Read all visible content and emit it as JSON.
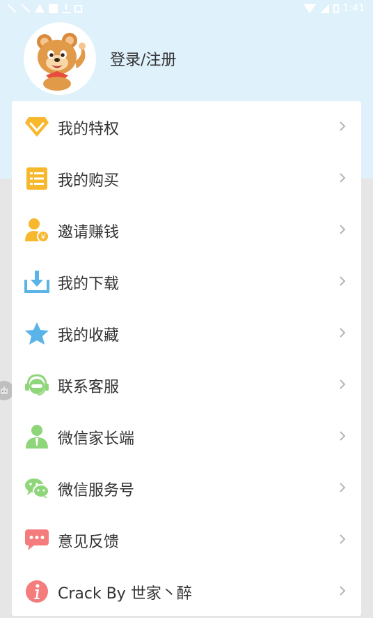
{
  "status_bar": {
    "time": "1:41"
  },
  "profile": {
    "login_label": "登录/注册",
    "avatar_icon": "bear-mascot-icon"
  },
  "menu": {
    "items": [
      {
        "label": "我的特权",
        "icon": "diamond-icon",
        "color": "#f7b82e"
      },
      {
        "label": "我的购买",
        "icon": "list-icon",
        "color": "#f7b82e"
      },
      {
        "label": "邀请赚钱",
        "icon": "user-coin-icon",
        "color": "#f7b82e"
      },
      {
        "label": "我的下载",
        "icon": "download-icon",
        "color": "#5ab4e8"
      },
      {
        "label": "我的收藏",
        "icon": "star-icon",
        "color": "#5ab4e8"
      },
      {
        "label": "联系客服",
        "icon": "service-icon",
        "color": "#8fd67a"
      },
      {
        "label": "微信家长端",
        "icon": "person-icon",
        "color": "#8fd67a"
      },
      {
        "label": "微信服务号",
        "icon": "wechat-icon",
        "color": "#8fd67a"
      },
      {
        "label": "意见反馈",
        "icon": "chat-bubble-icon",
        "color": "#f47c7c"
      },
      {
        "label": "Crack By 世家丶醉",
        "icon": "info-icon",
        "color": "#f47c7c"
      }
    ]
  },
  "colors": {
    "header_bg": "#dff1fb",
    "page_bg": "#e6e6e6",
    "card_bg": "#ffffff",
    "chevron": "#b5b5b5"
  }
}
